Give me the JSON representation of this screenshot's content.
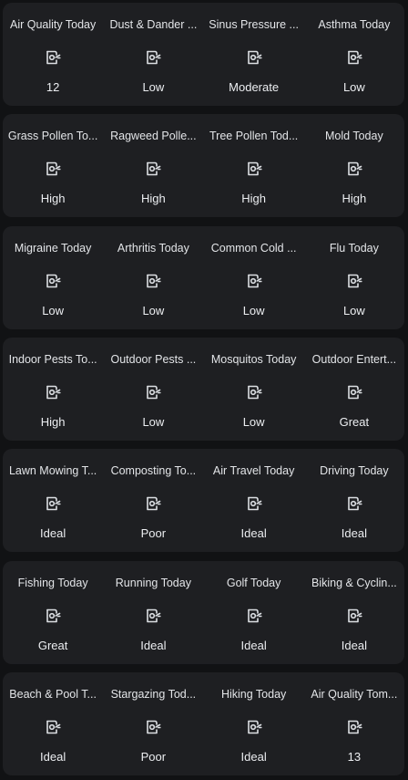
{
  "cards": [
    {
      "items": [
        {
          "name": "Air Quality Today",
          "value": "12"
        },
        {
          "name": "Dust & Dander ...",
          "value": "Low"
        },
        {
          "name": "Sinus Pressure ...",
          "value": "Moderate"
        },
        {
          "name": "Asthma Today",
          "value": "Low"
        }
      ]
    },
    {
      "items": [
        {
          "name": "Grass Pollen To...",
          "value": "High"
        },
        {
          "name": "Ragweed Polle...",
          "value": "High"
        },
        {
          "name": "Tree Pollen Tod...",
          "value": "High"
        },
        {
          "name": "Mold Today",
          "value": "High"
        }
      ]
    },
    {
      "items": [
        {
          "name": "Migraine Today",
          "value": "Low"
        },
        {
          "name": "Arthritis Today",
          "value": "Low"
        },
        {
          "name": "Common Cold ...",
          "value": "Low"
        },
        {
          "name": "Flu Today",
          "value": "Low"
        }
      ]
    },
    {
      "items": [
        {
          "name": "Indoor Pests To...",
          "value": "High"
        },
        {
          "name": "Outdoor Pests ...",
          "value": "Low"
        },
        {
          "name": "Mosquitos Today",
          "value": "Low"
        },
        {
          "name": "Outdoor Entert...",
          "value": "Great"
        }
      ]
    },
    {
      "items": [
        {
          "name": "Lawn Mowing T...",
          "value": "Ideal"
        },
        {
          "name": "Composting To...",
          "value": "Poor"
        },
        {
          "name": "Air Travel Today",
          "value": "Ideal"
        },
        {
          "name": "Driving Today",
          "value": "Ideal"
        }
      ]
    },
    {
      "items": [
        {
          "name": "Fishing Today",
          "value": "Great"
        },
        {
          "name": "Running Today",
          "value": "Ideal"
        },
        {
          "name": "Golf Today",
          "value": "Ideal"
        },
        {
          "name": "Biking & Cyclin...",
          "value": "Ideal"
        }
      ]
    },
    {
      "items": [
        {
          "name": "Beach & Pool T...",
          "value": "Ideal"
        },
        {
          "name": "Stargazing Tod...",
          "value": "Poor"
        },
        {
          "name": "Hiking Today",
          "value": "Ideal"
        },
        {
          "name": "Air Quality Tom...",
          "value": "13"
        }
      ]
    }
  ],
  "icon": "sensor-gauge-icon",
  "colors": {
    "background": "#111214",
    "card": "#1e1f22",
    "text": "#e3e5e8",
    "icon": "#dcdfe3"
  }
}
